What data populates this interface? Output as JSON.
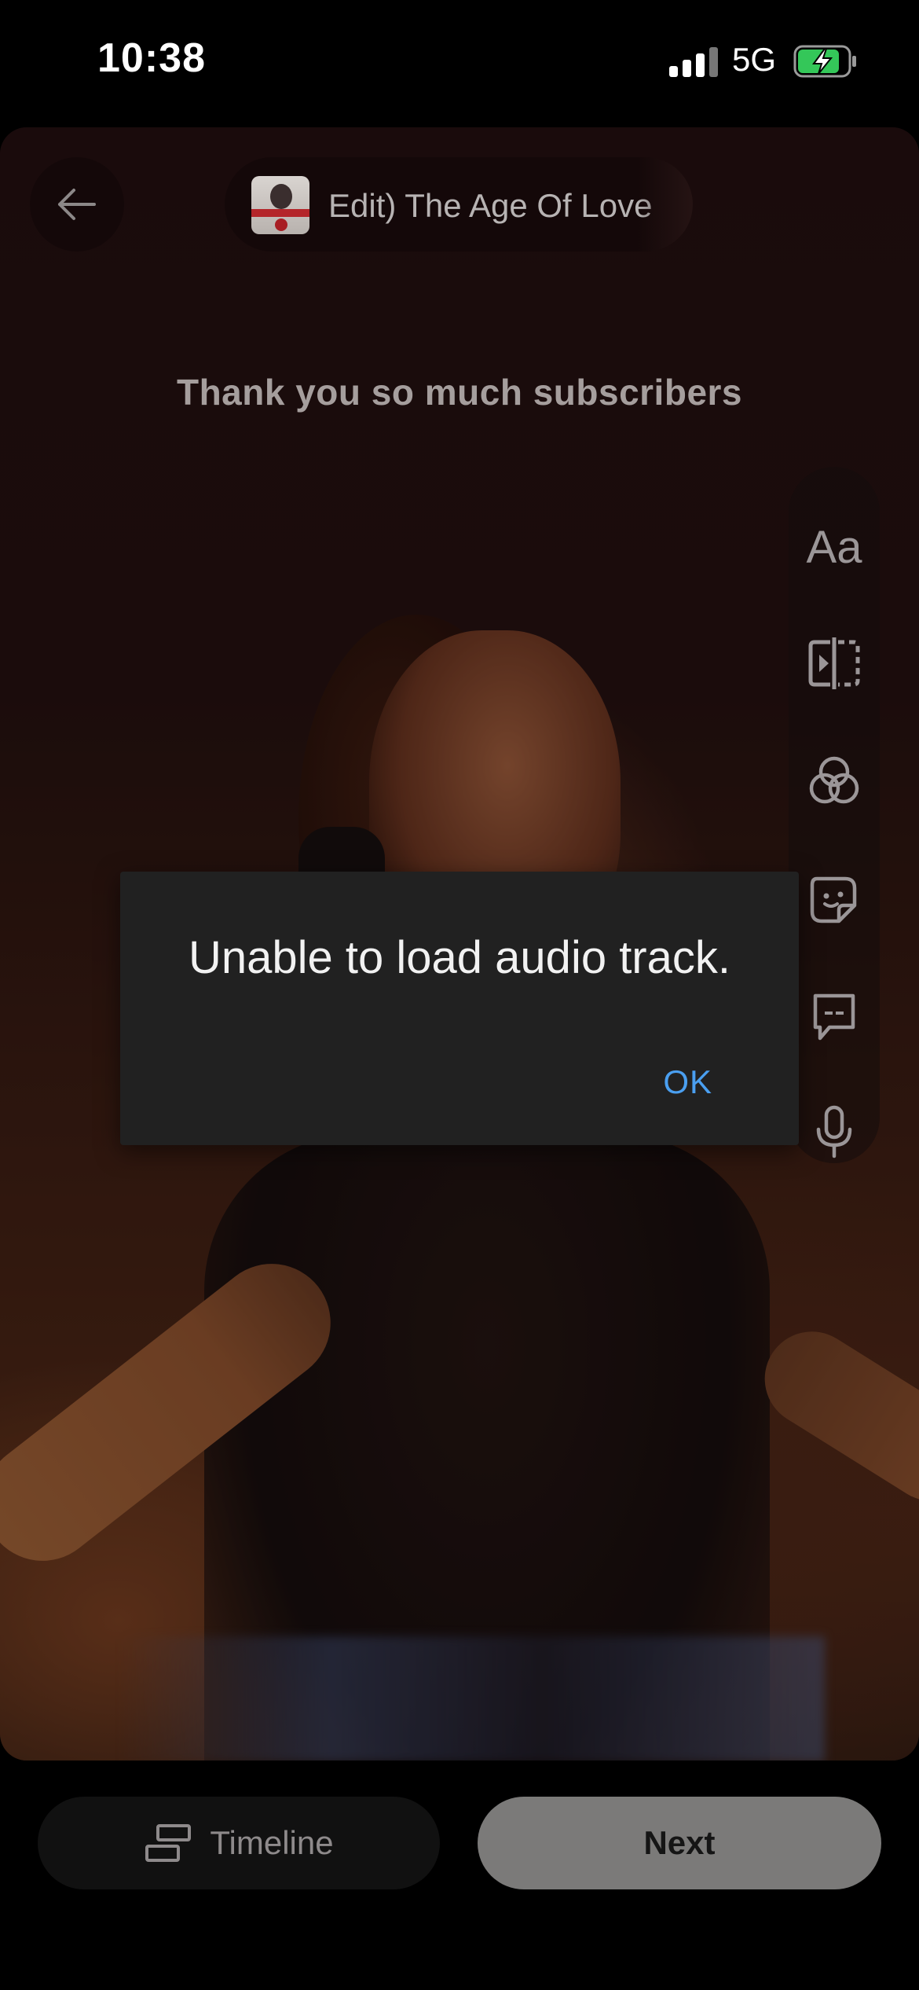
{
  "status_bar": {
    "time": "10:38",
    "network": "5G",
    "battery_state": "charging",
    "battery_color": "#34c759"
  },
  "editor": {
    "back_icon": "arrow-left-icon",
    "music_title": "Edit)   The Age Of Love",
    "caption": "Thank you so much subscribers",
    "tools": [
      {
        "name": "text-tool",
        "label": "Aa",
        "icon": "text-icon"
      },
      {
        "name": "split-tool",
        "icon": "split-clip-icon"
      },
      {
        "name": "filters-tool",
        "icon": "filters-icon"
      },
      {
        "name": "sticker-tool",
        "icon": "sticker-icon"
      },
      {
        "name": "captions-tool",
        "icon": "captions-icon"
      },
      {
        "name": "voiceover-tool",
        "icon": "microphone-icon"
      }
    ]
  },
  "dialog": {
    "message": "Unable to load audio track.",
    "ok_label": "OK",
    "ok_color": "#4a9ff0"
  },
  "bottom_bar": {
    "timeline_label": "Timeline",
    "timeline_icon": "timeline-icon",
    "next_label": "Next"
  }
}
